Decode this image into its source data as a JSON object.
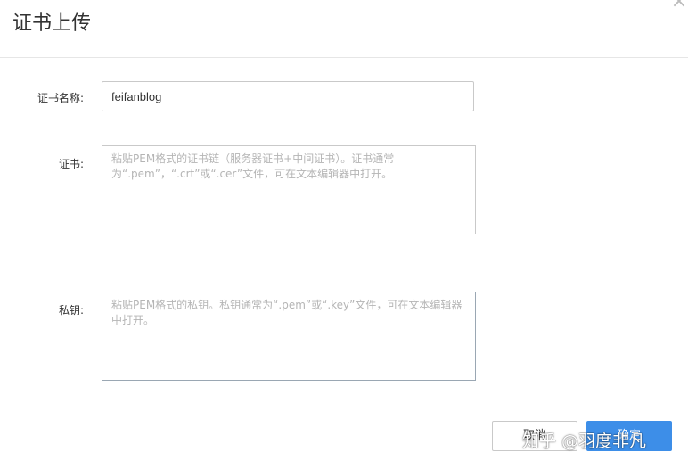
{
  "dialog": {
    "title": "证书上传",
    "close_icon": "×"
  },
  "form": {
    "name_label": "证书名称:",
    "name_value": "feifanblog",
    "cert_label": "证书:",
    "cert_placeholder": "粘贴PEM格式的证书链（服务器证书+中间证书）。证书通常为“.pem”，“.crt”或“.cer”文件，可在文本编辑器中打开。",
    "key_label": "私钥:",
    "key_placeholder": "粘贴PEM格式的私钥。私钥通常为“.pem”或“.key”文件，可在文本编辑器中打开。"
  },
  "buttons": {
    "cancel_label": "取消",
    "ok_label": "确定"
  },
  "watermark": {
    "text": "知乎 @羽度非凡"
  }
}
